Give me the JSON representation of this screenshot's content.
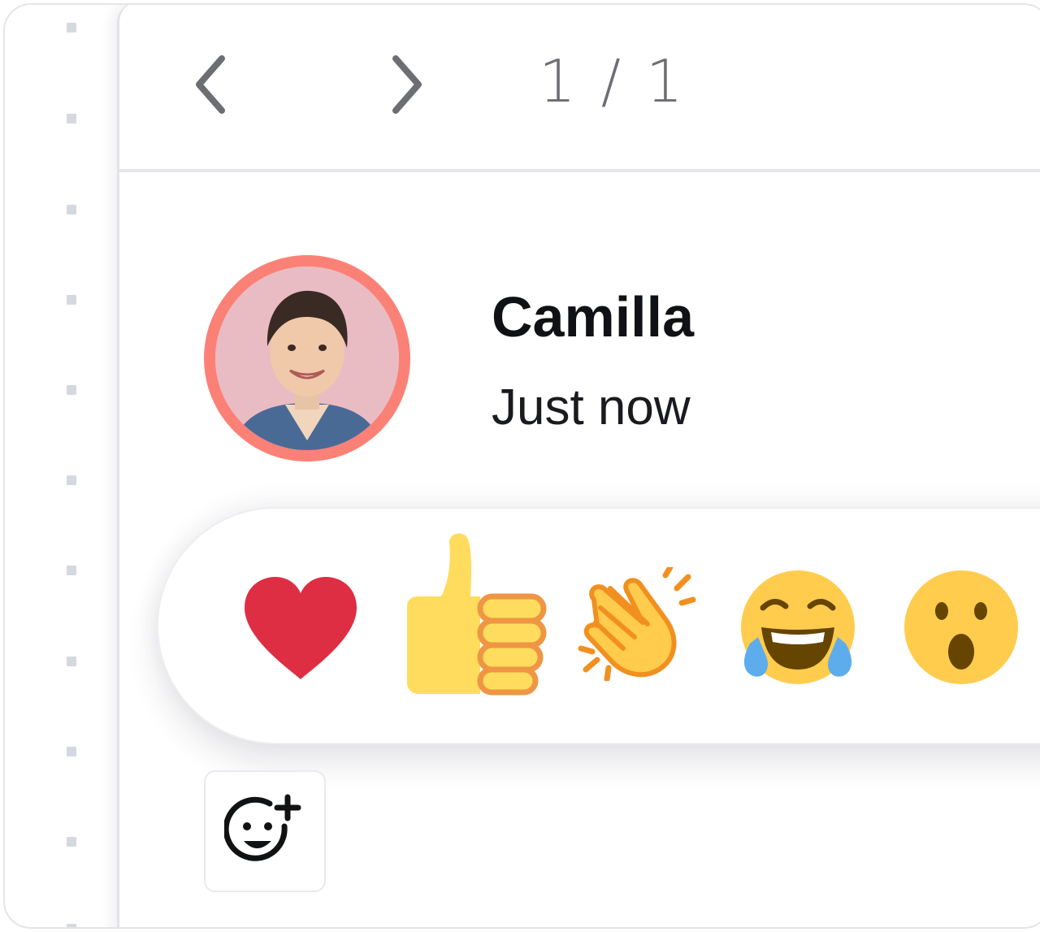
{
  "pager": {
    "text": "1 / 1"
  },
  "comment": {
    "author": "Camilla",
    "timestamp": "Just now"
  },
  "reactions": [
    {
      "icon": "heart-emoji"
    },
    {
      "icon": "thumbs-up-emoji"
    },
    {
      "icon": "clapping-hands-emoji"
    },
    {
      "icon": "tears-of-joy-emoji"
    },
    {
      "icon": "surprised-face-emoji"
    }
  ],
  "colors": {
    "avatar_ring": "#fb8177",
    "heart": "#dd2e44",
    "emoji_yellow": "#ffcc4d",
    "emoji_orange": "#f19020",
    "tear_blue": "#5dadec",
    "icon_gray": "#6c6e73"
  }
}
